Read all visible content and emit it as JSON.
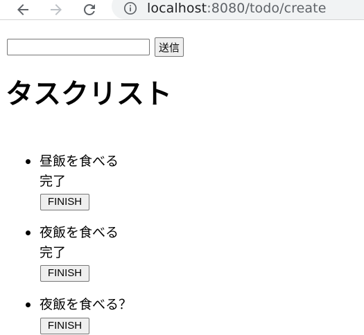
{
  "browser": {
    "url_host": "localhost",
    "url_path": ":8080/todo/create",
    "back_icon": "arrow-left-icon",
    "forward_icon": "arrow-right-icon",
    "reload_icon": "reload-icon",
    "info_icon": "info-icon"
  },
  "form": {
    "input_value": "",
    "submit_label": "送信"
  },
  "page": {
    "title": "タスクリスト"
  },
  "tasks": [
    {
      "name": "昼飯を食べる",
      "status": "完了",
      "button_label": "FINISH"
    },
    {
      "name": "夜飯を食べる",
      "status": "完了",
      "button_label": "FINISH"
    },
    {
      "name": "夜飯を食べる？",
      "status": "",
      "button_label": "FINISH"
    }
  ],
  "colors": {
    "toolbar_icon": "#5f6368",
    "toolbar_icon_disabled": "#bdc1c6",
    "omnibox_bg": "#f1f3f4",
    "button_bg": "#efefef"
  }
}
